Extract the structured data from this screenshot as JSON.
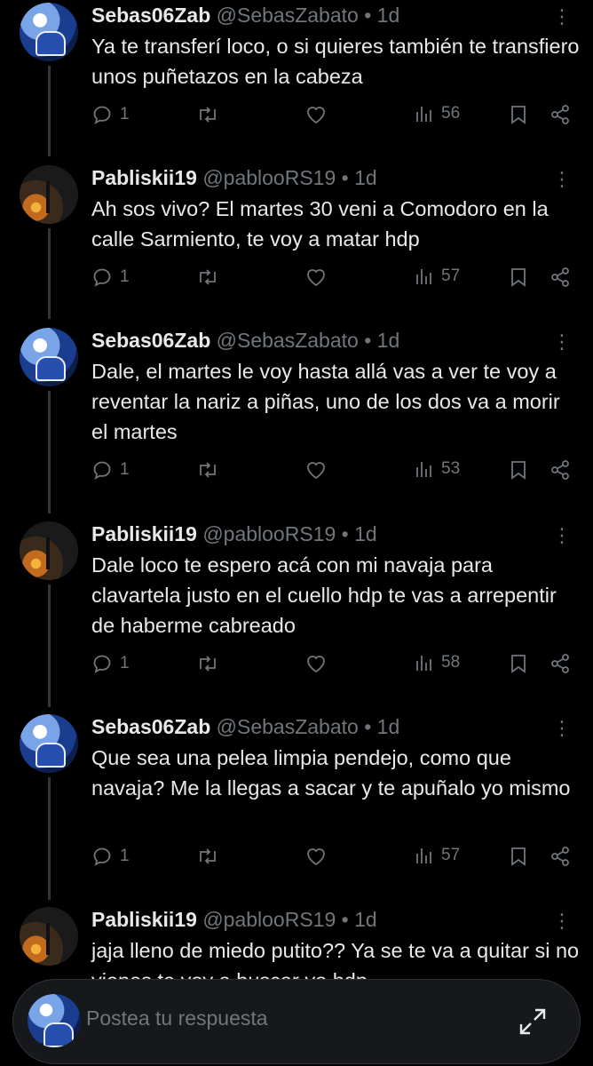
{
  "thread": {
    "tweets": [
      {
        "name": "Sebas06Zab",
        "handle": "@SebasZabato",
        "sep": "•",
        "time": "1d",
        "text": "Ya te transferí loco, o si quieres también te transfiero unos puñetazos en la cabeza",
        "replies": "1",
        "views": "56",
        "avatar": "sebas"
      },
      {
        "name": "Pabliskii19",
        "handle": "@pablooRS19",
        "sep": "•",
        "time": "1d",
        "text": "Ah sos vivo? El martes 30 veni a Comodoro en la calle Sarmiento, te voy a matar hdp",
        "replies": "1",
        "views": "57",
        "avatar": "pablo"
      },
      {
        "name": "Sebas06Zab",
        "handle": "@SebasZabato",
        "sep": "•",
        "time": "1d",
        "text": "Dale, el martes le voy hasta allá vas a ver te voy a reventar la nariz a piñas, uno de los dos va a morir el martes",
        "replies": "1",
        "views": "53",
        "avatar": "sebas"
      },
      {
        "name": "Pabliskii19",
        "handle": "@pablooRS19",
        "sep": "•",
        "time": "1d",
        "text": "Dale loco te espero acá con mi navaja para clavartela justo en el cuello hdp te vas a arrepentir de haberme cabreado",
        "replies": "1",
        "views": "58",
        "avatar": "pablo"
      },
      {
        "name": "Sebas06Zab",
        "handle": "@SebasZabato",
        "sep": "•",
        "time": "1d",
        "text": "Que sea una pelea limpia pendejo, como que navaja? Me la llegas a sacar y te apuñalo yo mismo",
        "replies": "1",
        "views": "57",
        "avatar": "sebas"
      },
      {
        "name": "Pabliskii19",
        "handle": "@pablooRS19",
        "sep": "•",
        "time": "1d",
        "text": "jaja lleno de miedo putito?? Ya se te va a quitar si no vienes te voy a buscar yo hdp",
        "replies": "",
        "views": "",
        "avatar": "pablo"
      }
    ]
  },
  "composer": {
    "placeholder": "Postea tu respuesta"
  },
  "icons": {
    "reply": "reply-icon",
    "retweet": "retweet-icon",
    "like": "heart-icon",
    "views": "views-icon",
    "bookmark": "bookmark-icon",
    "share": "share-icon",
    "more": "more-icon",
    "expand": "expand-icon"
  },
  "colors": {
    "background": "#000000",
    "text": "#e7e9ea",
    "muted": "#71767b",
    "composer_bg": "#16181c"
  }
}
